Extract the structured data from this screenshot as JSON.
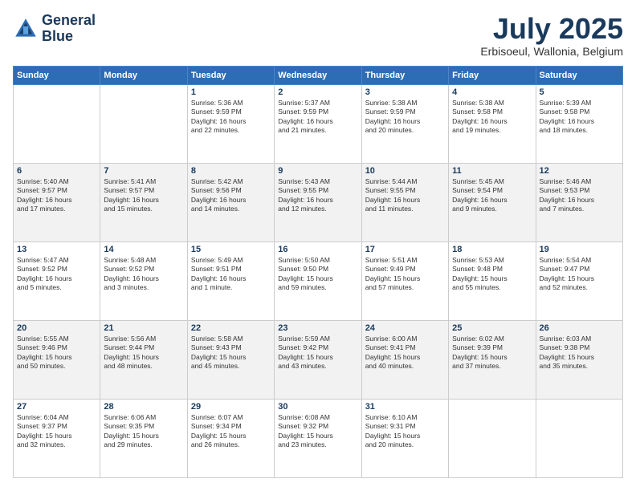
{
  "header": {
    "logo_line1": "General",
    "logo_line2": "Blue",
    "month": "July 2025",
    "location": "Erbisoeul, Wallonia, Belgium"
  },
  "weekdays": [
    "Sunday",
    "Monday",
    "Tuesday",
    "Wednesday",
    "Thursday",
    "Friday",
    "Saturday"
  ],
  "weeks": [
    [
      {
        "day": "",
        "info": ""
      },
      {
        "day": "",
        "info": ""
      },
      {
        "day": "1",
        "info": "Sunrise: 5:36 AM\nSunset: 9:59 PM\nDaylight: 16 hours\nand 22 minutes."
      },
      {
        "day": "2",
        "info": "Sunrise: 5:37 AM\nSunset: 9:59 PM\nDaylight: 16 hours\nand 21 minutes."
      },
      {
        "day": "3",
        "info": "Sunrise: 5:38 AM\nSunset: 9:59 PM\nDaylight: 16 hours\nand 20 minutes."
      },
      {
        "day": "4",
        "info": "Sunrise: 5:38 AM\nSunset: 9:58 PM\nDaylight: 16 hours\nand 19 minutes."
      },
      {
        "day": "5",
        "info": "Sunrise: 5:39 AM\nSunset: 9:58 PM\nDaylight: 16 hours\nand 18 minutes."
      }
    ],
    [
      {
        "day": "6",
        "info": "Sunrise: 5:40 AM\nSunset: 9:57 PM\nDaylight: 16 hours\nand 17 minutes."
      },
      {
        "day": "7",
        "info": "Sunrise: 5:41 AM\nSunset: 9:57 PM\nDaylight: 16 hours\nand 15 minutes."
      },
      {
        "day": "8",
        "info": "Sunrise: 5:42 AM\nSunset: 9:56 PM\nDaylight: 16 hours\nand 14 minutes."
      },
      {
        "day": "9",
        "info": "Sunrise: 5:43 AM\nSunset: 9:55 PM\nDaylight: 16 hours\nand 12 minutes."
      },
      {
        "day": "10",
        "info": "Sunrise: 5:44 AM\nSunset: 9:55 PM\nDaylight: 16 hours\nand 11 minutes."
      },
      {
        "day": "11",
        "info": "Sunrise: 5:45 AM\nSunset: 9:54 PM\nDaylight: 16 hours\nand 9 minutes."
      },
      {
        "day": "12",
        "info": "Sunrise: 5:46 AM\nSunset: 9:53 PM\nDaylight: 16 hours\nand 7 minutes."
      }
    ],
    [
      {
        "day": "13",
        "info": "Sunrise: 5:47 AM\nSunset: 9:52 PM\nDaylight: 16 hours\nand 5 minutes."
      },
      {
        "day": "14",
        "info": "Sunrise: 5:48 AM\nSunset: 9:52 PM\nDaylight: 16 hours\nand 3 minutes."
      },
      {
        "day": "15",
        "info": "Sunrise: 5:49 AM\nSunset: 9:51 PM\nDaylight: 16 hours\nand 1 minute."
      },
      {
        "day": "16",
        "info": "Sunrise: 5:50 AM\nSunset: 9:50 PM\nDaylight: 15 hours\nand 59 minutes."
      },
      {
        "day": "17",
        "info": "Sunrise: 5:51 AM\nSunset: 9:49 PM\nDaylight: 15 hours\nand 57 minutes."
      },
      {
        "day": "18",
        "info": "Sunrise: 5:53 AM\nSunset: 9:48 PM\nDaylight: 15 hours\nand 55 minutes."
      },
      {
        "day": "19",
        "info": "Sunrise: 5:54 AM\nSunset: 9:47 PM\nDaylight: 15 hours\nand 52 minutes."
      }
    ],
    [
      {
        "day": "20",
        "info": "Sunrise: 5:55 AM\nSunset: 9:46 PM\nDaylight: 15 hours\nand 50 minutes."
      },
      {
        "day": "21",
        "info": "Sunrise: 5:56 AM\nSunset: 9:44 PM\nDaylight: 15 hours\nand 48 minutes."
      },
      {
        "day": "22",
        "info": "Sunrise: 5:58 AM\nSunset: 9:43 PM\nDaylight: 15 hours\nand 45 minutes."
      },
      {
        "day": "23",
        "info": "Sunrise: 5:59 AM\nSunset: 9:42 PM\nDaylight: 15 hours\nand 43 minutes."
      },
      {
        "day": "24",
        "info": "Sunrise: 6:00 AM\nSunset: 9:41 PM\nDaylight: 15 hours\nand 40 minutes."
      },
      {
        "day": "25",
        "info": "Sunrise: 6:02 AM\nSunset: 9:39 PM\nDaylight: 15 hours\nand 37 minutes."
      },
      {
        "day": "26",
        "info": "Sunrise: 6:03 AM\nSunset: 9:38 PM\nDaylight: 15 hours\nand 35 minutes."
      }
    ],
    [
      {
        "day": "27",
        "info": "Sunrise: 6:04 AM\nSunset: 9:37 PM\nDaylight: 15 hours\nand 32 minutes."
      },
      {
        "day": "28",
        "info": "Sunrise: 6:06 AM\nSunset: 9:35 PM\nDaylight: 15 hours\nand 29 minutes."
      },
      {
        "day": "29",
        "info": "Sunrise: 6:07 AM\nSunset: 9:34 PM\nDaylight: 15 hours\nand 26 minutes."
      },
      {
        "day": "30",
        "info": "Sunrise: 6:08 AM\nSunset: 9:32 PM\nDaylight: 15 hours\nand 23 minutes."
      },
      {
        "day": "31",
        "info": "Sunrise: 6:10 AM\nSunset: 9:31 PM\nDaylight: 15 hours\nand 20 minutes."
      },
      {
        "day": "",
        "info": ""
      },
      {
        "day": "",
        "info": ""
      }
    ]
  ]
}
